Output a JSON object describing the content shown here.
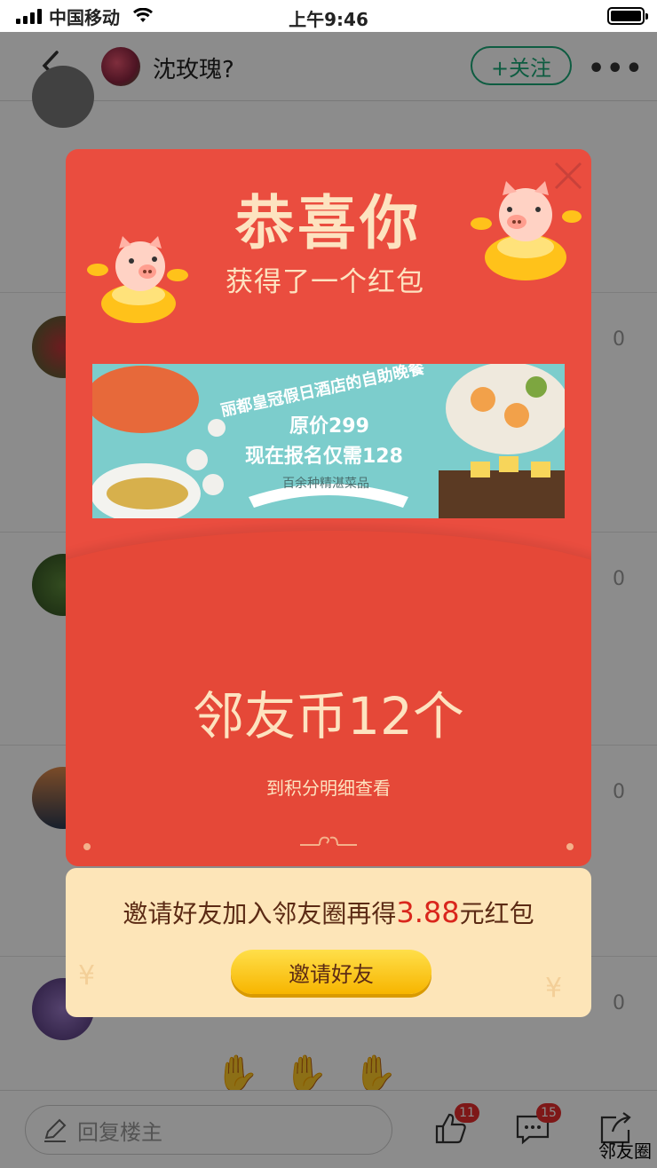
{
  "status_bar": {
    "carrier": "中国移动",
    "time": "上午9:46"
  },
  "nav": {
    "title": "沈玫瑰?",
    "follow_label": "+关注",
    "more_label": "•••"
  },
  "feed": {
    "likes": [
      "0",
      "0",
      "0",
      "0"
    ]
  },
  "popup": {
    "title": "恭喜你",
    "subtitle": "获得了一个红包",
    "banner": {
      "line1": "丽都皇冠假日酒店的自助晚餐",
      "line2": "原价299",
      "line3": "现在报名仅需128",
      "ribbon": "百余种精湛菜品"
    },
    "amount": "邻友币12个",
    "detail_link": "到积分明细查看",
    "invite": {
      "text_before": "邀请好友加入邻友圈再得",
      "money": "3.88",
      "text_after": "元红包",
      "button": "邀请好友"
    }
  },
  "bottom_bar": {
    "reply_placeholder": "回复楼主",
    "like_count": "11",
    "comment_count": "15"
  },
  "brand": "邻友圈",
  "colors": {
    "packet_red": "#ea4d3f",
    "accent_green": "#1aa877",
    "gold_text": "#fde3c0",
    "invite_bg": "#fde5b8"
  }
}
